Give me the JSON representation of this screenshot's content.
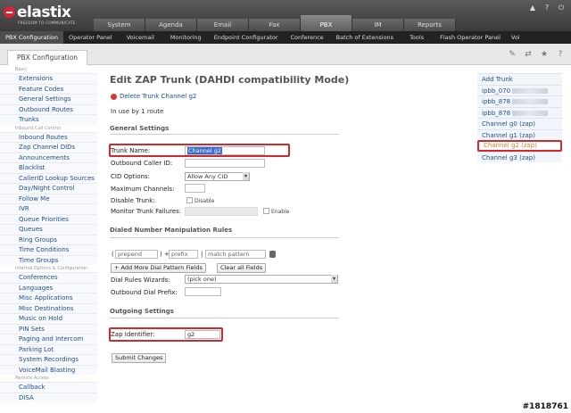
{
  "brand": {
    "name": "elastix",
    "tagline": "FREEDOM TO COMMUNICATE"
  },
  "main_tabs": [
    "System",
    "Agenda",
    "Email",
    "Fax",
    "PBX",
    "IM",
    "Reports"
  ],
  "top_icons": [
    "user-icon",
    "help-icon",
    "power-icon"
  ],
  "sub_menu": [
    "PBX Configuration",
    "Operator Panel",
    "Voicemail",
    "Monitoring",
    "Endpoint Configurator",
    "Conference",
    "Batch of Extensions",
    "Tools",
    "Flash Operator Panel",
    "Voi"
  ],
  "breadcrumb": {
    "tab": "PBX Configuration"
  },
  "crumb_icons": [
    "edit-icon",
    "arrows-icon",
    "star-icon",
    "help-icon"
  ],
  "sidebar": {
    "groups": [
      {
        "heading": "Basic",
        "items": [
          "Extensions",
          "Feature Codes",
          "General Settings",
          "Outbound Routes",
          "Trunks"
        ]
      },
      {
        "heading": "Inbound Call Control",
        "items": [
          "Inbound Routes",
          "Zap Channel DIDs",
          "Announcements",
          "Blacklist",
          "CallerID Lookup Sources",
          "Day/Night Control",
          "Follow Me",
          "IVR",
          "Queue Priorities",
          "Queues",
          "Ring Groups",
          "Time Conditions",
          "Time Groups"
        ]
      },
      {
        "heading": "Internal Options & Configuration",
        "items": [
          "Conferences",
          "Languages",
          "Misc Applications",
          "Misc Destinations",
          "Music on Hold",
          "PIN Sets",
          "Paging and Intercom",
          "Parking Lot",
          "System Recordings",
          "VoiceMail Blasting"
        ]
      },
      {
        "heading": "Remote Access",
        "items": [
          "Callback",
          "DISA"
        ]
      }
    ]
  },
  "page": {
    "title": "Edit ZAP Trunk (DAHDI compatibility Mode)",
    "delete_link": "Delete Trunk Channel g2",
    "in_use": "In use by 1 route",
    "general_heading": "General Settings",
    "fields": {
      "trunk_name_label": "Trunk Name:",
      "trunk_name_value": "Channel g2",
      "outbound_cid_label": "Outbound Caller ID:",
      "outbound_cid_value": "",
      "cid_options_label": "CID Options:",
      "cid_options_value": "Allow Any CID",
      "max_channels_label": "Maximum Channels:",
      "max_channels_value": "",
      "disable_trunk_label": "Disable Trunk:",
      "disable_label": "Disable",
      "monitor_label": "Monitor Trunk Failures:",
      "enable_label": "Enable"
    },
    "dial_heading": "Dialed Number Manipulation Rules",
    "pattern": {
      "open": "(",
      "prepend": "prepend",
      "close_plus": ") +",
      "prefix": "prefix",
      "pipe": "|",
      "match": "match pattern"
    },
    "add_more_button": "+ Add More Dial Pattern Fields",
    "clear_button": "Clear all Fields",
    "dial_wizard_label": "Dial Rules Wizards:",
    "dial_wizard_value": "(pick one)",
    "outbound_prefix_label": "Outbound Dial Prefix:",
    "outgoing_heading": "Outgoing Settings",
    "zap_identifier_label": "Zap Identifier:",
    "zap_identifier_value": "g2",
    "submit_button": "Submit Changes"
  },
  "trunk_list": {
    "add": "Add Trunk",
    "items": [
      {
        "label": "ipbb_070",
        "blurred": true
      },
      {
        "label": "ipbb_878",
        "blurred": true
      },
      {
        "label": "ipbb_878",
        "blurred": true
      },
      {
        "label": "Channel g0 (zap)",
        "blurred": false
      },
      {
        "label": "Channel g1 (zap)",
        "blurred": false
      },
      {
        "label": "Channel g2 (zap)",
        "blurred": false,
        "current": true
      },
      {
        "label": "Channel g3 (zap)",
        "blurred": false
      }
    ]
  },
  "watermark": "#1818761",
  "colors": {
    "link": "#1c4d94",
    "highlight": "#d0282e",
    "current_item": "#e07a20"
  }
}
